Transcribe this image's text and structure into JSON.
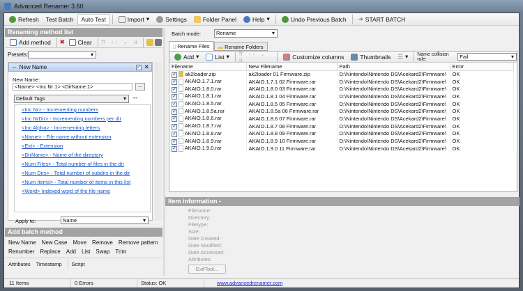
{
  "window": {
    "title": "Advanced Renamer 3.60"
  },
  "toolbar": {
    "refresh": "Refresh",
    "test_batch": "Test Batch",
    "auto_test": "Auto Test",
    "import": "Import",
    "settings": "Settings",
    "folder_panel": "Folder Panel",
    "help": "Help",
    "undo": "Undo Previous Batch",
    "start": "START BATCH"
  },
  "left": {
    "header": "Renaming method list",
    "add_method": "Add method",
    "clear": "Clear",
    "presets_label": "Presets:",
    "presets_value": "",
    "method": {
      "title": "New Name",
      "new_name_label": "New Name:",
      "new_name_value": "<Name> <Inc Nr:1> <DirName:1>",
      "browse": "...",
      "tags_select": "Default Tags",
      "tags": [
        "<Inc Nr> - Incrementing numbers",
        "<Inc NrDir> - Incrementing numbers per dir",
        "<Inc Alpha> - Incrementing letters",
        "<Name> - File name without extension",
        "<Ext> - Extension",
        "<DirName> - Name of the directory",
        "<Num Files> - Total number of files in the dir",
        "<Num Dirs> - Total number of subdirs in the dir",
        "<Num Items> - Total number of items in this list",
        "<Word> Indexed word of the file name"
      ],
      "apply_label": "Apply to:",
      "apply_value": "Name"
    }
  },
  "batch_methods": {
    "header": "Add batch method",
    "row1": [
      "New Name",
      "New Case",
      "Move",
      "Remove",
      "Remove pattern"
    ],
    "row2": [
      "Renumber",
      "Replace",
      "Add",
      "List",
      "Swap",
      "Trim"
    ],
    "row3": [
      "Attributes",
      "Timestamp",
      "Script"
    ]
  },
  "right": {
    "batch_mode_label": "Batch mode:",
    "batch_mode_value": "Rename",
    "tabs": [
      "Rename Files",
      "Rename Folders"
    ],
    "toolbar": {
      "add": "Add",
      "list": "List",
      "customize": "Customize columns",
      "thumbnails": "Thumbnails",
      "collision_label": "Name collision rule:",
      "collision_value": "Fail"
    },
    "columns": [
      "Filename",
      "New Filename",
      "Path",
      "Error"
    ],
    "rows": [
      [
        "ak2loader.zip",
        "ak2loader 01 Firmware.zip",
        "D:\\Nintendo\\Nintendo DS\\Acekard2\\Firmware\\",
        "OK"
      ],
      [
        "AKAIO.1.7.1.rar",
        "AKAIO.1.7.1 02 Firmware.rar",
        "D:\\Nintendo\\Nintendo DS\\Acekard2\\Firmware\\",
        "OK"
      ],
      [
        "AKAIO.1.8.0.rar",
        "AKAIO.1.8.0 03 Firmware.rar",
        "D:\\Nintendo\\Nintendo DS\\Acekard2\\Firmware\\",
        "OK"
      ],
      [
        "AKAIO.1.8.1.rar",
        "AKAIO.1.8.1 04 Firmware.rar",
        "D:\\Nintendo\\Nintendo DS\\Acekard2\\Firmware\\",
        "OK"
      ],
      [
        "AKAIO.1.8.5.rar",
        "AKAIO.1.8.5 05 Firmware.rar",
        "D:\\Nintendo\\Nintendo DS\\Acekard2\\Firmware\\",
        "OK"
      ],
      [
        "AKAIO.1.8.5a.rar",
        "AKAIO.1.8.5a 06 Firmware.rar",
        "D:\\Nintendo\\Nintendo DS\\Acekard2\\Firmware\\",
        "OK"
      ],
      [
        "AKAIO.1.8.6.rar",
        "AKAIO.1.8.6 07 Firmware.rar",
        "D:\\Nintendo\\Nintendo DS\\Acekard2\\Firmware\\",
        "OK"
      ],
      [
        "AKAIO.1.8.7.rar",
        "AKAIO.1.8.7 08 Firmware.rar",
        "D:\\Nintendo\\Nintendo DS\\Acekard2\\Firmware\\",
        "OK"
      ],
      [
        "AKAIO.1.8.8.rar",
        "AKAIO.1.8.8 09 Firmware.rar",
        "D:\\Nintendo\\Nintendo DS\\Acekard2\\Firmware\\",
        "OK"
      ],
      [
        "AKAIO.1.8.9.rar",
        "AKAIO.1.8.9 10 Firmware.rar",
        "D:\\Nintendo\\Nintendo DS\\Acekard2\\Firmware\\",
        "OK"
      ],
      [
        "AKAIO.1.9.0.rar",
        "AKAIO.1.9.0 11 Firmware.rar",
        "D:\\Nintendo\\Nintendo DS\\Acekard2\\Firmware\\",
        "OK"
      ]
    ],
    "item_info": {
      "header": "Item information -",
      "labels": [
        "Filename:",
        "Directory:",
        "Filetype:",
        "Size:",
        "Date Created:",
        "Date Modified:",
        "Date Accessed:",
        "Attributes:"
      ],
      "exiftool": "ExifTool..."
    }
  },
  "status": {
    "items": "11 Items",
    "errors": "0 Errors",
    "status": "Status: OK",
    "website": "www.advancedrenamer.com"
  }
}
